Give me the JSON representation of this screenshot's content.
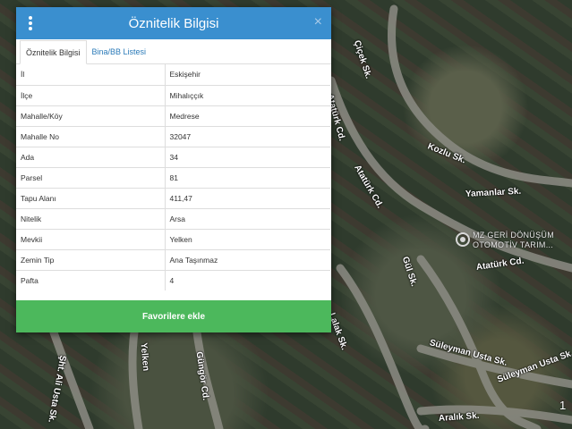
{
  "dialog": {
    "title": "Öznitelik Bilgisi",
    "close_glyph": "×",
    "icons": {
      "menu": "vertical-dots-menu-icon",
      "close": "close-icon"
    },
    "tabs": [
      {
        "label": "Öznitelik Bilgisi",
        "active": true
      },
      {
        "label": "Bina/BB Listesi",
        "active": false
      }
    ],
    "rows": [
      {
        "key": "İl",
        "value": "Eskişehir"
      },
      {
        "key": "İlçe",
        "value": "Mihalıççık"
      },
      {
        "key": "Mahalle/Köy",
        "value": "Medrese"
      },
      {
        "key": "Mahalle No",
        "value": "32047"
      },
      {
        "key": "Ada",
        "value": "34"
      },
      {
        "key": "Parsel",
        "value": "81"
      },
      {
        "key": "Tapu Alanı",
        "value": "411,47"
      },
      {
        "key": "Nitelik",
        "value": "Arsa"
      },
      {
        "key": "Mevkii",
        "value": "Yelken"
      },
      {
        "key": "Zemin Tip",
        "value": "Ana Taşınmaz"
      },
      {
        "key": "Pafta",
        "value": "4"
      }
    ],
    "favorite_button": "Favorilere ekle"
  },
  "map": {
    "streets": [
      "Çiçek Sk.",
      "Atatürk Cd.",
      "Kozlu Sk.",
      "Yamanlar Sk.",
      "Atatürk Cd.",
      "Atatürk Cd.",
      "Gül Sk.",
      "Lalak Sk.",
      "Süleyman Usta Sk.",
      "Süleyman Usta Sk.",
      "Aralık Sk.",
      "Güngör Cd.",
      "Yelken",
      "Şht. Ali Usta Sk."
    ],
    "poi_label": [
      "MZ GERİ DÖNÜŞÜM",
      "OTOMOTİV TARIM..."
    ],
    "scale_text": "1"
  },
  "colors": {
    "header": "#3a8fcf",
    "button": "#4cb85c",
    "tab_link": "#2a7ab8"
  }
}
